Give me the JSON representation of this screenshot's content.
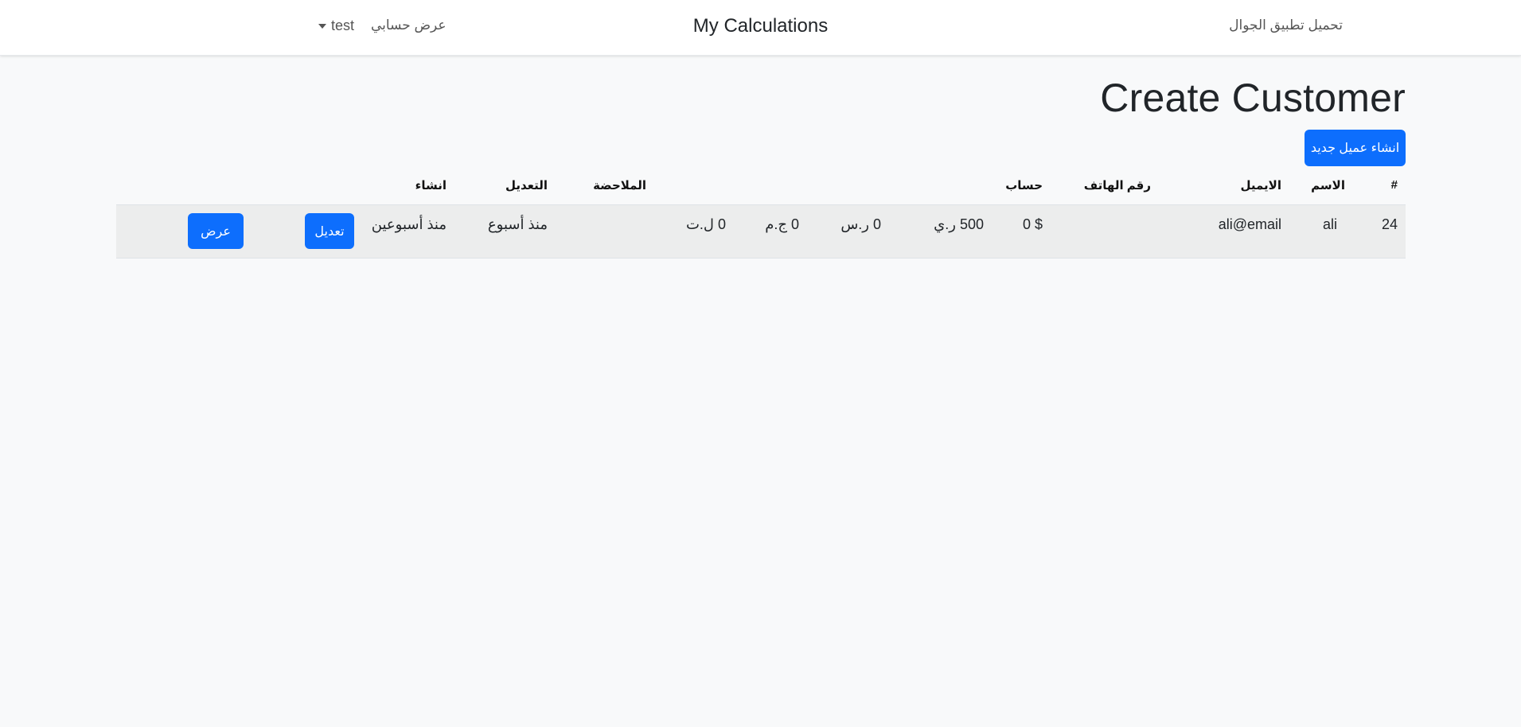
{
  "navbar": {
    "download_app": "تحميل تطبيق الجوال",
    "brand": "My Calculations",
    "view_account": "عرض حسابي",
    "user_name": "test",
    "user_menu_icon": "caret-down-icon"
  },
  "page": {
    "title": "Create Customer",
    "create_button": "انشاء عميل جديد"
  },
  "table": {
    "headers": {
      "number": "#",
      "name": "الاسم",
      "email": "الايميل",
      "phone": "رقم الهاتف",
      "account": "حساب",
      "note": "الملاحضة",
      "modified": "التعديل",
      "created": "انشاء"
    },
    "rows": [
      {
        "number": "24",
        "name": "ali",
        "email": "ali@email",
        "phone": "",
        "usd": "0 $",
        "yer": "500 ر.ي",
        "sar": "0 ر.س",
        "egp": "0 ج.م",
        "try": "0 ل.ت",
        "note": "",
        "modified": "منذ أسبوع",
        "created": "منذ أسبوعين",
        "edit_label": "تعديل",
        "view_label": "عرض"
      }
    ]
  },
  "colors": {
    "primary": "#0d6efd",
    "page_background": "#f8f9fa",
    "row_background": "#eceded"
  }
}
